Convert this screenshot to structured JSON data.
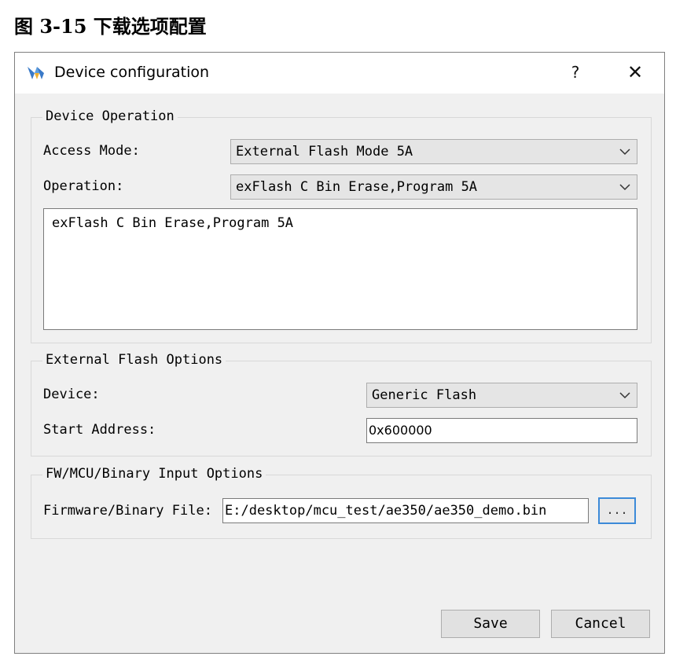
{
  "caption": "图 3-15 下载选项配置",
  "window": {
    "title": "Device configuration",
    "help": "?",
    "close": "✕"
  },
  "device_operation": {
    "legend": "Device Operation",
    "access_mode_label": "Access Mode:",
    "access_mode_value": "External Flash Mode 5A",
    "operation_label": "Operation:",
    "operation_value": "exFlash C Bin Erase,Program 5A",
    "description": "exFlash C Bin Erase,Program 5A"
  },
  "external_flash": {
    "legend": "External Flash Options",
    "device_label": "Device:",
    "device_value": "Generic Flash",
    "start_address_label": "Start Address:",
    "start_address_value": "0x600000"
  },
  "input_options": {
    "legend": "FW/MCU/Binary Input Options",
    "file_label": "Firmware/Binary File:",
    "file_value": "E:/desktop/mcu_test/ae350/ae350_demo.bin",
    "browse_label": "..."
  },
  "buttons": {
    "save": "Save",
    "cancel": "Cancel"
  },
  "colors": {
    "dialog_bg": "#f0f0f0",
    "combo_bg": "#e5e5e5",
    "focus_border": "#3c8ad8"
  }
}
